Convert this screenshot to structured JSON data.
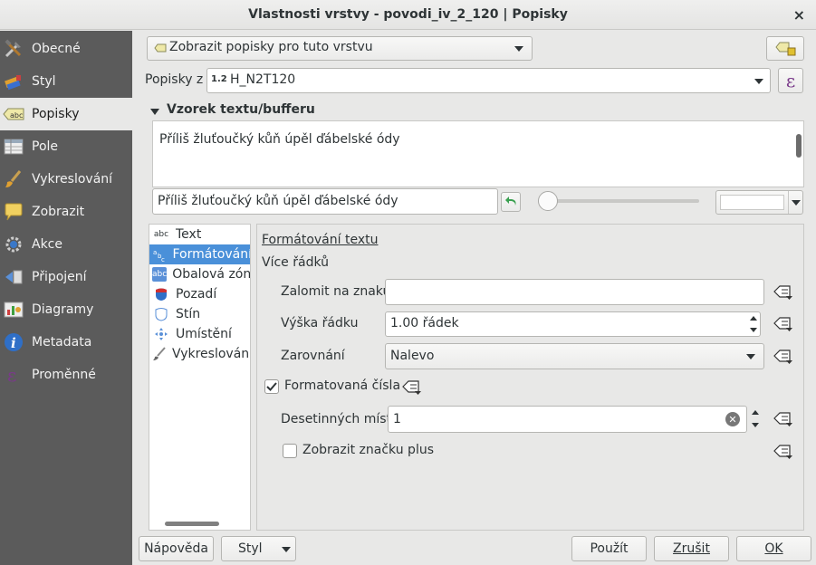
{
  "window": {
    "title": "Vlastnosti vrstvy - povodi_iv_2_120 | Popisky",
    "close_label": "×"
  },
  "sidebar": {
    "items": [
      {
        "label": "Obecné",
        "icon": "wrench-hammer-icon"
      },
      {
        "label": "Styl",
        "icon": "paint-icon"
      },
      {
        "label": "Popisky",
        "icon": "abc-label-icon"
      },
      {
        "label": "Pole",
        "icon": "table-icon"
      },
      {
        "label": "Vykreslování",
        "icon": "brush-icon"
      },
      {
        "label": "Zobrazit",
        "icon": "speech-bubble-icon"
      },
      {
        "label": "Akce",
        "icon": "gear-icon"
      },
      {
        "label": "Připojení",
        "icon": "join-icon"
      },
      {
        "label": "Diagramy",
        "icon": "chart-icon"
      },
      {
        "label": "Metadata",
        "icon": "info-icon"
      },
      {
        "label": "Proměnné",
        "icon": "epsilon-icon"
      }
    ],
    "active_index": 2
  },
  "top": {
    "mode_combo": "Zobrazit popisky pro tuto vrstvu",
    "labels_from_label": "Popisky z",
    "field_type": "1.2",
    "field_value": "H_N2T120",
    "expression_symbol": "ε"
  },
  "sample": {
    "section_title": "Vzorek textu/bufferu",
    "preview_text": "Příliš žluťoučký kůň úpěl ďábelské ódy",
    "input_text": "Příliš žluťoučký kůň úpěl ďábelské ódy"
  },
  "tabs": [
    {
      "label": "Text",
      "icon": "abc"
    },
    {
      "label": "Formátování",
      "icon": "formatting-icon"
    },
    {
      "label": "Obalová zóna",
      "icon": "abc"
    },
    {
      "label": "Pozadí",
      "icon": "shield-icon"
    },
    {
      "label": "Stín",
      "icon": "shadow-icon"
    },
    {
      "label": "Umístění",
      "icon": "placement-icon"
    },
    {
      "label": "Vykreslování",
      "icon": "brush-icon"
    }
  ],
  "formatting": {
    "title": "Formátování textu",
    "multiline_title": "Více řádků",
    "wrap_label": "Zalomit na znaku",
    "wrap_value": "",
    "line_height_label": "Výška řádku",
    "line_height_value": "1.00 řádek",
    "alignment_label": "Zarovnání",
    "alignment_value": "Nalevo",
    "formatted_numbers_label": "Formatovaná čísla",
    "formatted_numbers_checked": true,
    "decimals_label": "Desetinných míst",
    "decimals_value": "1",
    "show_plus_label": "Zobrazit značku plus",
    "show_plus_checked": false
  },
  "buttons": {
    "help": "Nápověda",
    "style": "Styl",
    "apply": "Použít",
    "cancel": "Zrušit",
    "ok": "OK"
  }
}
